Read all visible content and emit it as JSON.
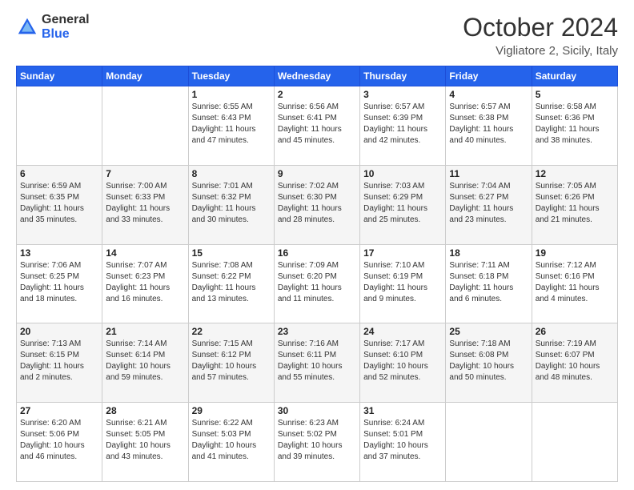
{
  "header": {
    "logo_general": "General",
    "logo_blue": "Blue",
    "month_title": "October 2024",
    "subtitle": "Vigliatore 2, Sicily, Italy"
  },
  "calendar": {
    "headers": [
      "Sunday",
      "Monday",
      "Tuesday",
      "Wednesday",
      "Thursday",
      "Friday",
      "Saturday"
    ],
    "weeks": [
      [
        {
          "day": "",
          "sunrise": "",
          "sunset": "",
          "daylight": ""
        },
        {
          "day": "",
          "sunrise": "",
          "sunset": "",
          "daylight": ""
        },
        {
          "day": "1",
          "sunrise": "Sunrise: 6:55 AM",
          "sunset": "Sunset: 6:43 PM",
          "daylight": "Daylight: 11 hours and 47 minutes."
        },
        {
          "day": "2",
          "sunrise": "Sunrise: 6:56 AM",
          "sunset": "Sunset: 6:41 PM",
          "daylight": "Daylight: 11 hours and 45 minutes."
        },
        {
          "day": "3",
          "sunrise": "Sunrise: 6:57 AM",
          "sunset": "Sunset: 6:39 PM",
          "daylight": "Daylight: 11 hours and 42 minutes."
        },
        {
          "day": "4",
          "sunrise": "Sunrise: 6:57 AM",
          "sunset": "Sunset: 6:38 PM",
          "daylight": "Daylight: 11 hours and 40 minutes."
        },
        {
          "day": "5",
          "sunrise": "Sunrise: 6:58 AM",
          "sunset": "Sunset: 6:36 PM",
          "daylight": "Daylight: 11 hours and 38 minutes."
        }
      ],
      [
        {
          "day": "6",
          "sunrise": "Sunrise: 6:59 AM",
          "sunset": "Sunset: 6:35 PM",
          "daylight": "Daylight: 11 hours and 35 minutes."
        },
        {
          "day": "7",
          "sunrise": "Sunrise: 7:00 AM",
          "sunset": "Sunset: 6:33 PM",
          "daylight": "Daylight: 11 hours and 33 minutes."
        },
        {
          "day": "8",
          "sunrise": "Sunrise: 7:01 AM",
          "sunset": "Sunset: 6:32 PM",
          "daylight": "Daylight: 11 hours and 30 minutes."
        },
        {
          "day": "9",
          "sunrise": "Sunrise: 7:02 AM",
          "sunset": "Sunset: 6:30 PM",
          "daylight": "Daylight: 11 hours and 28 minutes."
        },
        {
          "day": "10",
          "sunrise": "Sunrise: 7:03 AM",
          "sunset": "Sunset: 6:29 PM",
          "daylight": "Daylight: 11 hours and 25 minutes."
        },
        {
          "day": "11",
          "sunrise": "Sunrise: 7:04 AM",
          "sunset": "Sunset: 6:27 PM",
          "daylight": "Daylight: 11 hours and 23 minutes."
        },
        {
          "day": "12",
          "sunrise": "Sunrise: 7:05 AM",
          "sunset": "Sunset: 6:26 PM",
          "daylight": "Daylight: 11 hours and 21 minutes."
        }
      ],
      [
        {
          "day": "13",
          "sunrise": "Sunrise: 7:06 AM",
          "sunset": "Sunset: 6:25 PM",
          "daylight": "Daylight: 11 hours and 18 minutes."
        },
        {
          "day": "14",
          "sunrise": "Sunrise: 7:07 AM",
          "sunset": "Sunset: 6:23 PM",
          "daylight": "Daylight: 11 hours and 16 minutes."
        },
        {
          "day": "15",
          "sunrise": "Sunrise: 7:08 AM",
          "sunset": "Sunset: 6:22 PM",
          "daylight": "Daylight: 11 hours and 13 minutes."
        },
        {
          "day": "16",
          "sunrise": "Sunrise: 7:09 AM",
          "sunset": "Sunset: 6:20 PM",
          "daylight": "Daylight: 11 hours and 11 minutes."
        },
        {
          "day": "17",
          "sunrise": "Sunrise: 7:10 AM",
          "sunset": "Sunset: 6:19 PM",
          "daylight": "Daylight: 11 hours and 9 minutes."
        },
        {
          "day": "18",
          "sunrise": "Sunrise: 7:11 AM",
          "sunset": "Sunset: 6:18 PM",
          "daylight": "Daylight: 11 hours and 6 minutes."
        },
        {
          "day": "19",
          "sunrise": "Sunrise: 7:12 AM",
          "sunset": "Sunset: 6:16 PM",
          "daylight": "Daylight: 11 hours and 4 minutes."
        }
      ],
      [
        {
          "day": "20",
          "sunrise": "Sunrise: 7:13 AM",
          "sunset": "Sunset: 6:15 PM",
          "daylight": "Daylight: 11 hours and 2 minutes."
        },
        {
          "day": "21",
          "sunrise": "Sunrise: 7:14 AM",
          "sunset": "Sunset: 6:14 PM",
          "daylight": "Daylight: 10 hours and 59 minutes."
        },
        {
          "day": "22",
          "sunrise": "Sunrise: 7:15 AM",
          "sunset": "Sunset: 6:12 PM",
          "daylight": "Daylight: 10 hours and 57 minutes."
        },
        {
          "day": "23",
          "sunrise": "Sunrise: 7:16 AM",
          "sunset": "Sunset: 6:11 PM",
          "daylight": "Daylight: 10 hours and 55 minutes."
        },
        {
          "day": "24",
          "sunrise": "Sunrise: 7:17 AM",
          "sunset": "Sunset: 6:10 PM",
          "daylight": "Daylight: 10 hours and 52 minutes."
        },
        {
          "day": "25",
          "sunrise": "Sunrise: 7:18 AM",
          "sunset": "Sunset: 6:08 PM",
          "daylight": "Daylight: 10 hours and 50 minutes."
        },
        {
          "day": "26",
          "sunrise": "Sunrise: 7:19 AM",
          "sunset": "Sunset: 6:07 PM",
          "daylight": "Daylight: 10 hours and 48 minutes."
        }
      ],
      [
        {
          "day": "27",
          "sunrise": "Sunrise: 6:20 AM",
          "sunset": "Sunset: 5:06 PM",
          "daylight": "Daylight: 10 hours and 46 minutes."
        },
        {
          "day": "28",
          "sunrise": "Sunrise: 6:21 AM",
          "sunset": "Sunset: 5:05 PM",
          "daylight": "Daylight: 10 hours and 43 minutes."
        },
        {
          "day": "29",
          "sunrise": "Sunrise: 6:22 AM",
          "sunset": "Sunset: 5:03 PM",
          "daylight": "Daylight: 10 hours and 41 minutes."
        },
        {
          "day": "30",
          "sunrise": "Sunrise: 6:23 AM",
          "sunset": "Sunset: 5:02 PM",
          "daylight": "Daylight: 10 hours and 39 minutes."
        },
        {
          "day": "31",
          "sunrise": "Sunrise: 6:24 AM",
          "sunset": "Sunset: 5:01 PM",
          "daylight": "Daylight: 10 hours and 37 minutes."
        },
        {
          "day": "",
          "sunrise": "",
          "sunset": "",
          "daylight": ""
        },
        {
          "day": "",
          "sunrise": "",
          "sunset": "",
          "daylight": ""
        }
      ]
    ]
  }
}
